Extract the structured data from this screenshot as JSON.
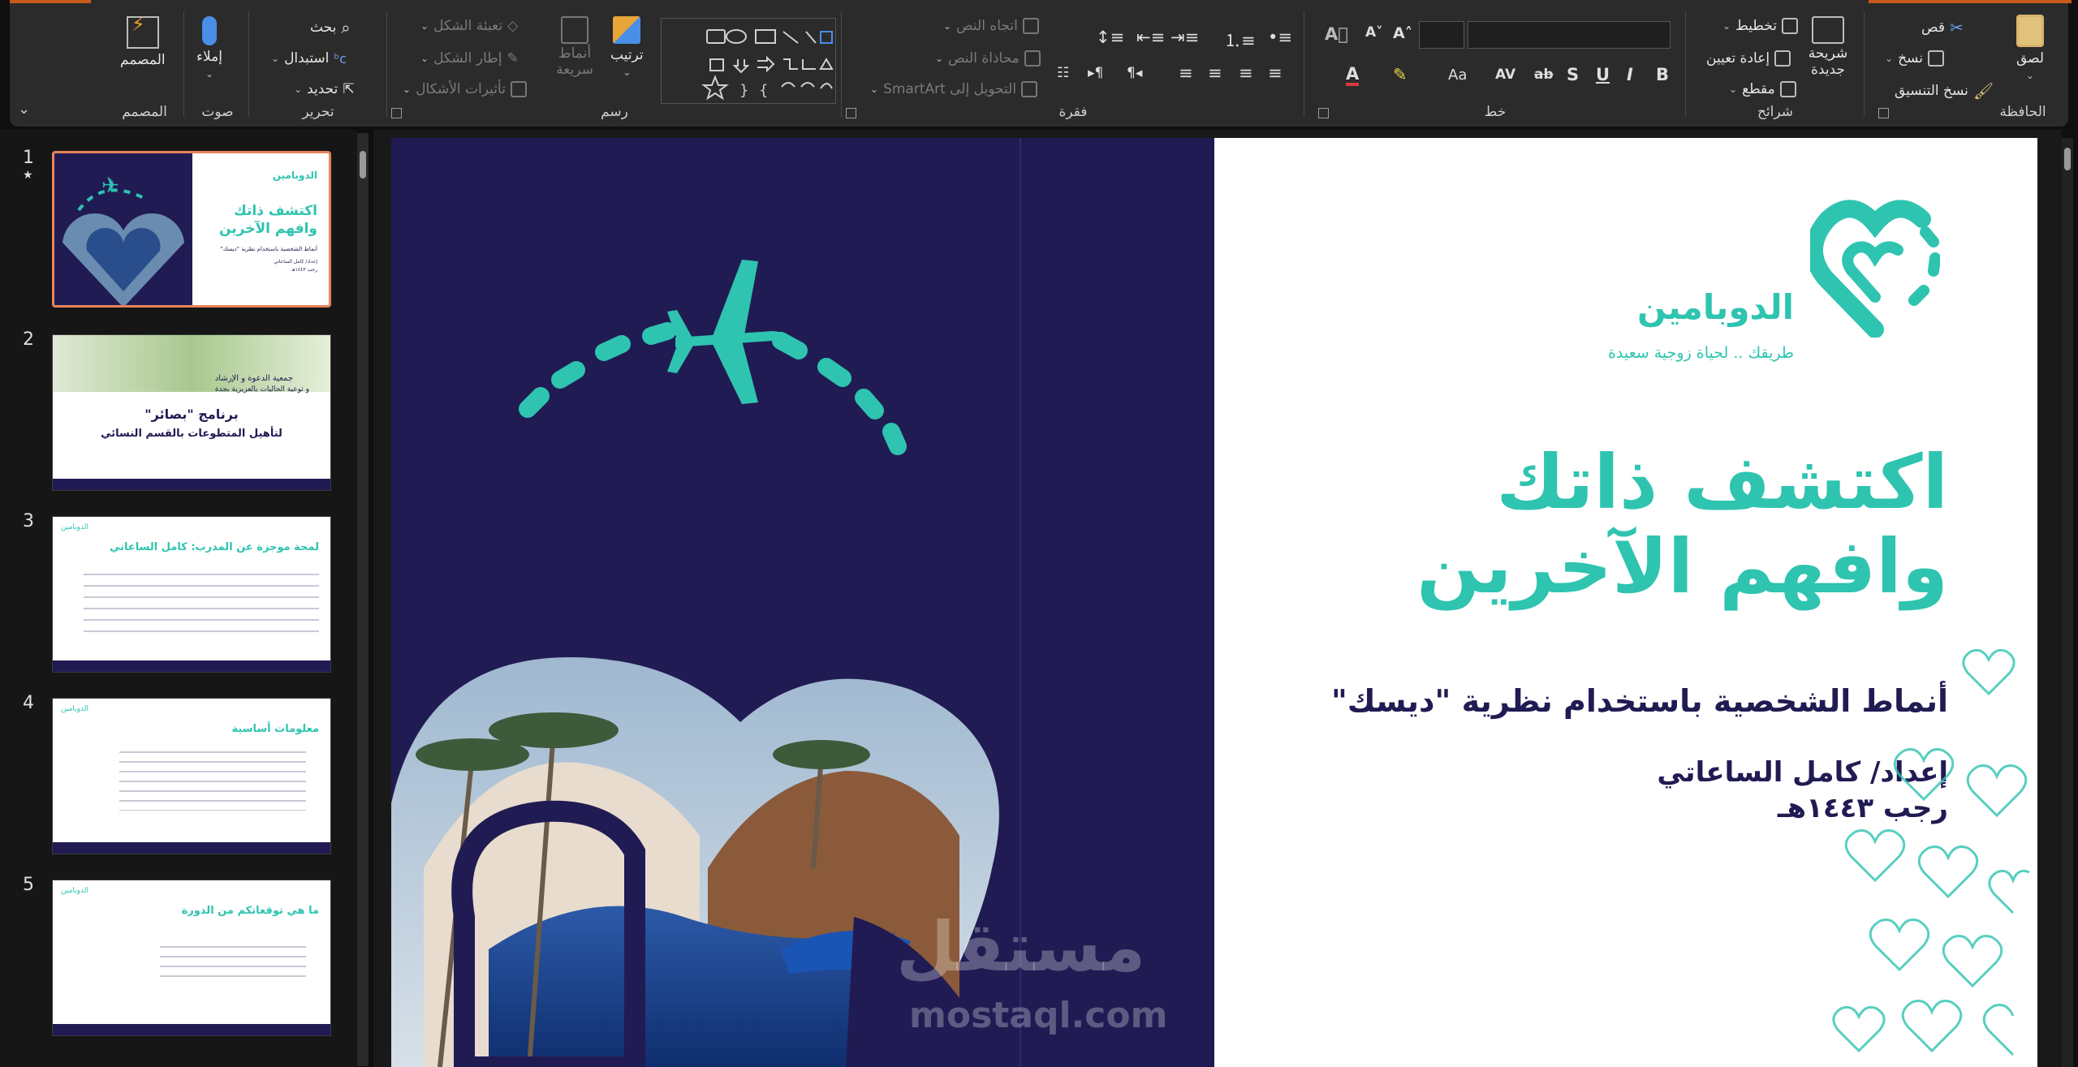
{
  "ribbon": {
    "clipboard": {
      "group": "الحافظة",
      "paste": "لصق",
      "cut": "قص",
      "copy": "نسخ",
      "format_painter": "نسخ التنسيق"
    },
    "slides": {
      "group": "شرائح",
      "new_slide": "شريحة جديدة",
      "layout": "تخطيط",
      "reset": "إعادة تعيين",
      "section": "مقطع"
    },
    "font": {
      "group": "خط",
      "bold": "B",
      "italic": "I",
      "underline": "U",
      "shadow": "S",
      "strike": "ab",
      "spacing": "AV",
      "case": "Aa"
    },
    "paragraph": {
      "group": "فقرة",
      "text_direction": "اتجاه النص",
      "align_text": "محاذاة النص",
      "smartart": "التحويل إلى SmartArt"
    },
    "drawing": {
      "group": "رسم",
      "arrange": "ترتيب",
      "quick_styles": "أنماط سريعة",
      "shape_fill": "تعبئة الشكل",
      "shape_outline": "إطار الشكل",
      "shape_effects": "تأثيرات الأشكال"
    },
    "editing": {
      "group": "تحرير",
      "find": "بحث",
      "replace": "استبدال",
      "select": "تحديد"
    },
    "voice": {
      "group": "صوت",
      "dictate": "إملاء"
    },
    "designer": {
      "group": "المصمم",
      "designer": "المصمم"
    }
  },
  "thumbnails": [
    {
      "num": "1",
      "title": "اكتشف ذاتك وافهم الآخرين",
      "sub": "أنماط الشخصية باستخدام نظرية \"ديسك\"",
      "meta1": "إعداد/ كامل الساعاتي",
      "meta2": "رجب ١٤٤٣هـ",
      "logo": "الدوبامين"
    },
    {
      "num": "2",
      "top1": "جمعية الدعوة و الإرشاد",
      "top2": "و توعية الجاليات بالعزيزية بجدة",
      "title": "برنامج \"بصائر\"",
      "sub": "لتأهيل المتطوعات بالقسم النسائي"
    },
    {
      "num": "3",
      "title": "لمحة موجزة عن المدرب: كامل الساعاتي",
      "logo": "الدوبامين"
    },
    {
      "num": "4",
      "title": "معلومات أساسية",
      "logo": "الدوبامين"
    },
    {
      "num": "5",
      "title": "ما هي توقعاتكم من الدورة",
      "logo": "الدوبامين"
    }
  ],
  "slide": {
    "logo_name": "الدوبامين",
    "logo_tagline": "طريقك .. لحياة زوجية سعيدة",
    "title_line1": "اكتشف ذاتك",
    "title_line2": "وافهم الآخرين",
    "subtitle": "أنماط الشخصية باستخدام نظرية \"ديسك\"",
    "author": "إعداد/ كامل الساعاتي",
    "date": "رجب ١٤٤٣هـ",
    "watermark_ar": "مستقل",
    "watermark_en": "mostaql.com"
  },
  "colors": {
    "teal": "#2ec4b0",
    "navy": "#211b53",
    "accent": "#c55a1a",
    "selection": "#e8845c"
  }
}
